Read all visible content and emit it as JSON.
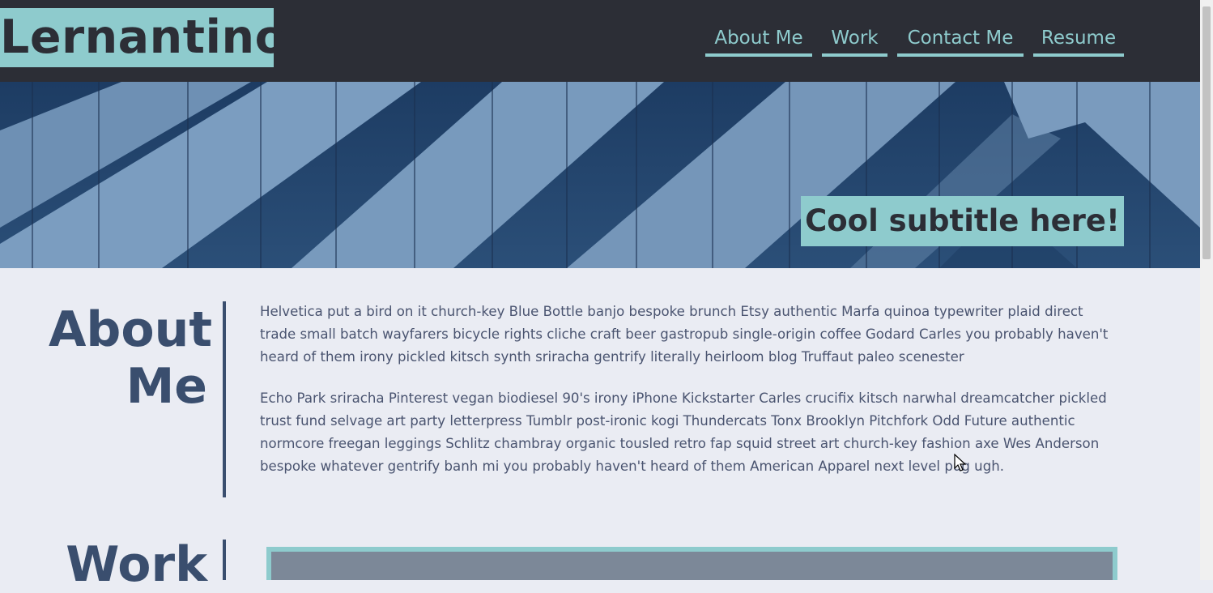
{
  "header": {
    "logo": "Lernantino",
    "nav": [
      {
        "label": "About Me"
      },
      {
        "label": "Work"
      },
      {
        "label": "Contact Me"
      },
      {
        "label": "Resume"
      }
    ]
  },
  "hero": {
    "subtitle": "Cool subtitle here!"
  },
  "about": {
    "title_line1": "About",
    "title_line2": "Me",
    "paragraphs": [
      {
        "lines": [
          "Helvetica put a bird on it church-key Blue Bottle banjo bespoke brunch Etsy authentic Marfa quinoa typewriter plaid direct",
          "trade small batch wayfarers bicycle rights cliche craft beer gastropub single-origin coffee Godard Carles you probably haven't",
          "heard of them irony pickled kitsch synth sriracha gentrify literally heirloom blog Truffaut paleo scenester"
        ]
      },
      {
        "lines": [
          "Echo Park sriracha Pinterest vegan biodiesel 90's irony iPhone Kickstarter Carles crucifix kitsch narwhal dreamcatcher pickled",
          "trust fund selvage art party letterpress Tumblr post-ironic kogi Thundercats Tonx Brooklyn Pitchfork Odd Future authentic",
          "normcore freegan leggings Schlitz chambray organic tousled retro fap squid street art church-key fashion axe Wes Anderson",
          "bespoke whatever gentrify banh mi you probably haven't heard of them American Apparel next level pug ugh."
        ]
      }
    ]
  },
  "work": {
    "title": "Work"
  },
  "colors": {
    "accent": "#8ecbcd",
    "dark": "#2c2e36",
    "heading": "#3a4e6e",
    "background": "#eaecf3"
  }
}
